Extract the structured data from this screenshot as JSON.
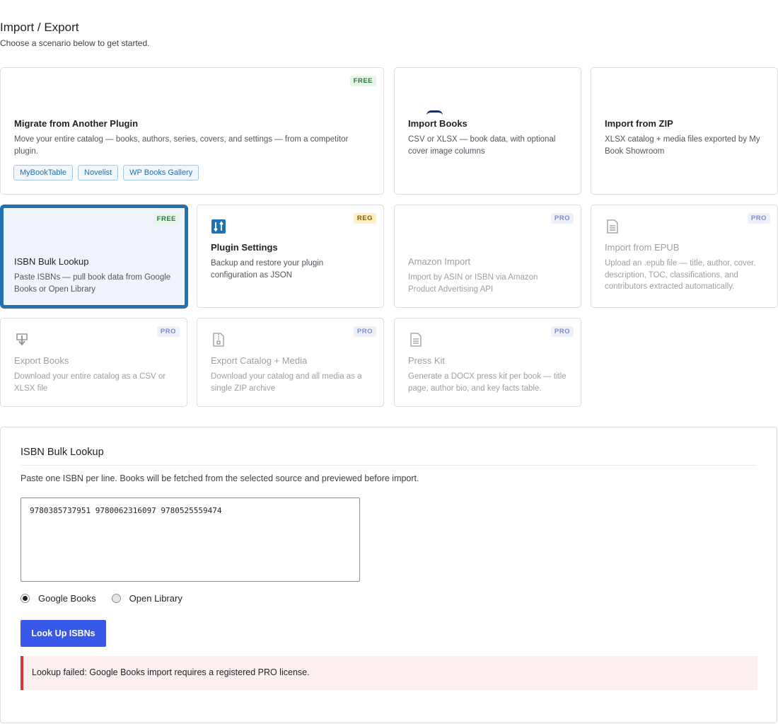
{
  "header": {
    "title": "Import / Export",
    "subtitle": "Choose a scenario below to get started."
  },
  "cards": {
    "migrate": {
      "badge": "FREE",
      "title": "Migrate from Another Plugin",
      "desc": "Move your entire catalog — books, authors, series, covers, and settings — from a competitor plugin.",
      "tags": [
        "MyBookTable",
        "Novelist",
        "WP Books Gallery"
      ]
    },
    "import_books": {
      "title": "Import Books",
      "desc": "CSV or XLSX — book data, with optional cover image columns"
    },
    "import_zip": {
      "title": "Import from ZIP",
      "desc": "XLSX catalog + media files exported by My Book Showroom"
    },
    "isbn_lookup": {
      "badge": "FREE",
      "title": "ISBN Bulk Lookup",
      "desc": "Paste ISBNs — pull book data from Google Books or Open Library"
    },
    "plugin_settings": {
      "badge": "REG",
      "title": "Plugin Settings",
      "desc": "Backup and restore your plugin configuration as JSON",
      "icon": "sliders-icon"
    },
    "amazon_import": {
      "badge": "PRO",
      "title": "Amazon Import",
      "desc": "Import by ASIN or ISBN via Amazon Product Advertising API"
    },
    "epub_import": {
      "badge": "PRO",
      "title": "Import from EPUB",
      "desc": "Upload an .epub file — title, author, cover, description, TOC, classifications, and contributors extracted automatically.",
      "icon": "document-icon"
    },
    "export_books": {
      "badge": "PRO",
      "title": "Export Books",
      "desc": "Download your entire catalog as a CSV or XLSX file",
      "icon": "download-icon"
    },
    "export_media": {
      "badge": "PRO",
      "title": "Export Catalog + Media",
      "desc": "Download your catalog and all media as a single ZIP archive",
      "icon": "zip-file-icon"
    },
    "press_kit": {
      "badge": "PRO",
      "title": "Press Kit",
      "desc": "Generate a DOCX press kit per book — title page, author bio, and key facts table.",
      "icon": "document-icon"
    }
  },
  "panel": {
    "title": "ISBN Bulk Lookup",
    "instructions": "Paste one ISBN per line. Books will be fetched from the selected source and previewed before import.",
    "isbn_value": "9780385737951 9780062316097 9780525559474",
    "sources": [
      {
        "label": "Google Books",
        "selected": true
      },
      {
        "label": "Open Library",
        "selected": false
      }
    ],
    "button_label": "Look Up ISBNs",
    "error": "Lookup failed: Google Books import requires a registered PRO license."
  },
  "colors": {
    "accent": "#2271b1",
    "button": "#3858e9",
    "error_border": "#d63638"
  }
}
